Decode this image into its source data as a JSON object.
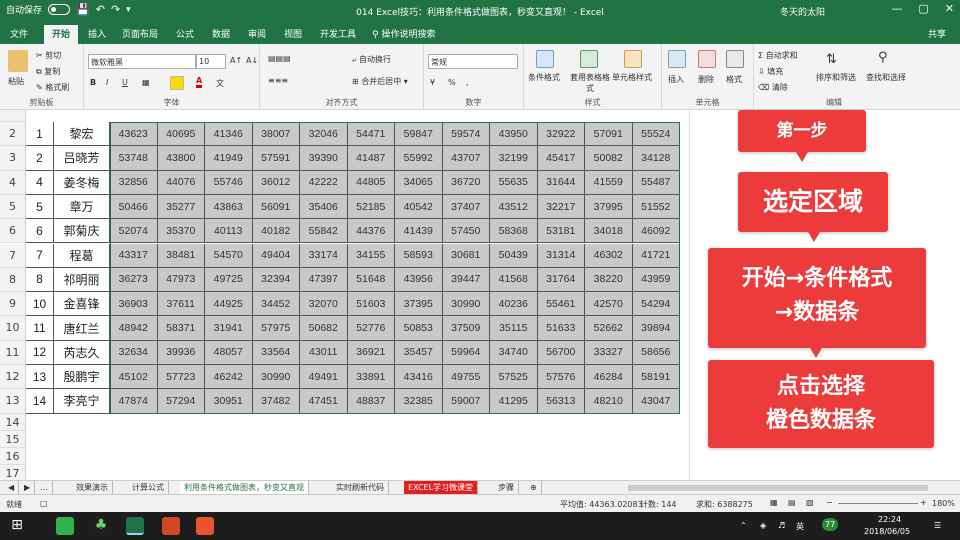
{
  "titlebar": {
    "autosave": "自动保存",
    "autosave_state": "关",
    "title": "014 Excel技巧：利用条件格式做图表，秒变又直观！ - Excel",
    "user": "冬天的太阳",
    "minimize": "—",
    "maximize": "▢",
    "close": "✕"
  },
  "tabs": [
    "文件",
    "开始",
    "插入",
    "页面布局",
    "公式",
    "数据",
    "审阅",
    "视图",
    "开发工具",
    "操作说明搜索",
    "共享"
  ],
  "active_tab": "开始",
  "ribbon": {
    "clipboard": {
      "label": "剪贴板",
      "paste": "粘贴",
      "cut": "剪切",
      "copy": "复制",
      "painter": "格式刷"
    },
    "font": {
      "label": "字体",
      "name": "微软雅黑",
      "size": "10",
      "bold": "B",
      "italic": "I",
      "underline": "U",
      "grow": "A↑",
      "shrink": "A↓",
      "color_a": "A",
      "wen": "文"
    },
    "align": {
      "label": "对齐方式",
      "wrap": "自动换行",
      "merge": "合并后居中"
    },
    "number": {
      "label": "数字",
      "format": "常规",
      "percent": "%",
      "comma": ","
    },
    "styles": {
      "label": "样式",
      "cond": "条件格式",
      "table": "套用表格格式",
      "cell": "单元格样式"
    },
    "cells": {
      "label": "单元格",
      "insert": "插入",
      "delete": "删除",
      "format": "格式"
    },
    "editing": {
      "label": "编辑",
      "autosum": "自动求和",
      "fill": "填充",
      "clear": "清除",
      "sort": "排序和筛选",
      "find": "查找和选择"
    }
  },
  "rows": [
    {
      "r": "2",
      "id": "1",
      "name": "黎宏",
      "v": [
        43623,
        40695,
        41346,
        38007,
        32046,
        54471,
        59847,
        59574,
        43950,
        32922,
        57091,
        55524
      ]
    },
    {
      "r": "3",
      "id": "2",
      "name": "吕晓芳",
      "v": [
        53748,
        43800,
        41949,
        57591,
        39390,
        41487,
        55992,
        43707,
        32199,
        45417,
        50082,
        34128
      ]
    },
    {
      "r": "4",
      "id": "4",
      "name": "姜冬梅",
      "v": [
        32856,
        44076,
        55746,
        36012,
        42222,
        44805,
        34065,
        36720,
        55635,
        31644,
        41559,
        55487
      ]
    },
    {
      "r": "5",
      "id": "5",
      "name": "章万",
      "v": [
        50466,
        35277,
        43863,
        56091,
        35406,
        52185,
        40542,
        37407,
        43512,
        32217,
        37995,
        51552
      ]
    },
    {
      "r": "6",
      "id": "6",
      "name": "郭菊庆",
      "v": [
        52074,
        35370,
        40113,
        40182,
        55842,
        44376,
        41439,
        57450,
        58368,
        53181,
        34018,
        46092
      ]
    },
    {
      "r": "7",
      "id": "7",
      "name": "程葛",
      "v": [
        43317,
        38481,
        54570,
        49404,
        33174,
        34155,
        58593,
        30681,
        50439,
        31314,
        46302,
        41721
      ]
    },
    {
      "r": "8",
      "id": "8",
      "name": "祁明丽",
      "v": [
        36273,
        47973,
        49725,
        32394,
        47397,
        51648,
        43956,
        39447,
        41568,
        31764,
        38220,
        43959
      ]
    },
    {
      "r": "9",
      "id": "10",
      "name": "金喜锋",
      "v": [
        36903,
        37611,
        44925,
        34452,
        32070,
        51603,
        37395,
        30990,
        40236,
        55461,
        42570,
        54294
      ]
    },
    {
      "r": "10",
      "id": "11",
      "name": "唐红兰",
      "v": [
        48942,
        58371,
        31941,
        57975,
        50682,
        52776,
        50853,
        37509,
        35115,
        51633,
        52662,
        39894
      ]
    },
    {
      "r": "11",
      "id": "12",
      "name": "芮志久",
      "v": [
        32634,
        39936,
        48057,
        33564,
        43011,
        36921,
        35457,
        59964,
        34740,
        56700,
        33327,
        58656
      ]
    },
    {
      "r": "12",
      "id": "13",
      "name": "殷鹏宇",
      "v": [
        45102,
        57723,
        46242,
        30990,
        49491,
        33891,
        43416,
        49755,
        57525,
        57576,
        46284,
        58191
      ]
    },
    {
      "r": "13",
      "id": "14",
      "name": "李亮宁",
      "v": [
        47874,
        57294,
        30951,
        37482,
        47451,
        48837,
        32385,
        59007,
        41295,
        56313,
        48210,
        43047
      ]
    }
  ],
  "empty_rows": [
    "14",
    "15",
    "16",
    "17",
    "18"
  ],
  "overlay": {
    "step": "第一步",
    "select": "选定区域",
    "action": [
      "开始→条件格式",
      "→数据条"
    ],
    "click": [
      "点击选择",
      "橙色数据条"
    ]
  },
  "sheet_tabs": [
    "效果演示",
    "计算公式",
    "利用条件格式做图表，秒变又直观",
    "实时刷新代码",
    "EXCEL学习微课堂",
    "步骤"
  ],
  "active_sheet": "利用条件格式做图表，秒变又直观",
  "status": {
    "mode": "就绪",
    "avg": "平均值: 44363.02083",
    "count": "计数: 144",
    "sum": "求和: 6388275",
    "zoom": "180%"
  },
  "taskbar": {
    "lang": "英",
    "badge": "77",
    "time": "22:24",
    "date": "2018/06/05"
  },
  "colors": {
    "excel_green": "#217346",
    "selected_fill": "#c9c9c9",
    "overlay_red": "#eb3b3b"
  }
}
